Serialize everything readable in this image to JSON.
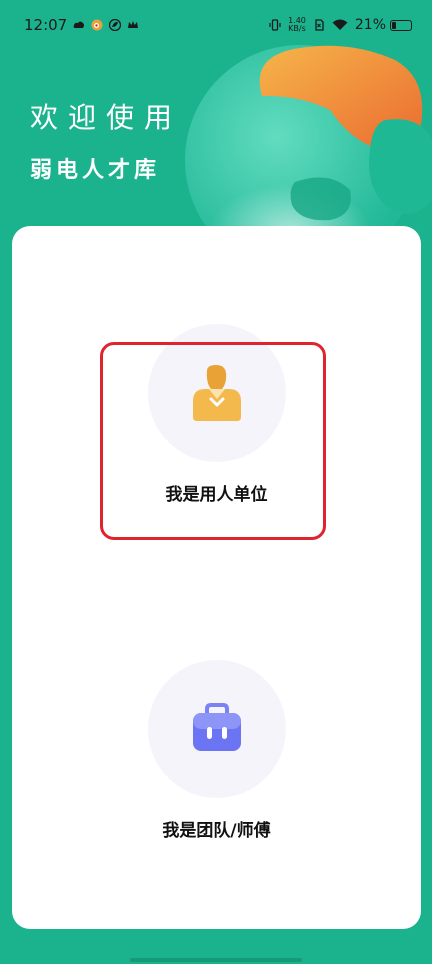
{
  "status_bar": {
    "time": "12:07",
    "net_speed_value": "1.40",
    "net_speed_unit": "KB/s",
    "battery": "21%"
  },
  "header": {
    "welcome": "欢迎使用",
    "app_name": "弱电人才库"
  },
  "options": {
    "employer_label": "我是用人单位",
    "team_label": "我是团队/师傅"
  },
  "icons": {
    "employer": "person-badge-icon",
    "team": "briefcase-icon"
  },
  "colors": {
    "background": "#1bb38d",
    "card": "#ffffff",
    "highlight": "#e0242f",
    "employer_icon": "#f2a93b",
    "team_icon": "#6b74f2"
  }
}
